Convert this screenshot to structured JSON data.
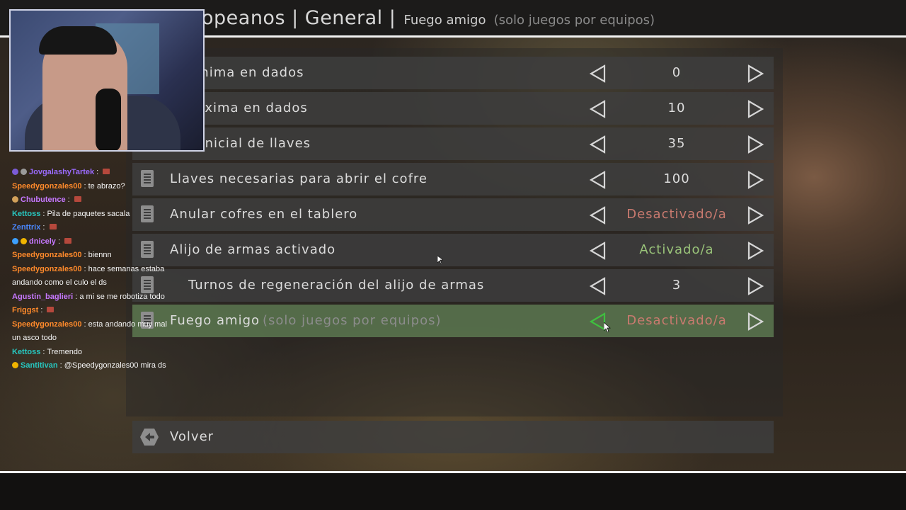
{
  "header": {
    "title": "opeanos | General |",
    "subtitle": "Fuego amigo",
    "subtitle_hint": "(solo juegos por equipos)"
  },
  "settings": [
    {
      "label": "a mínima en dados",
      "value": "0",
      "value_state": "normal"
    },
    {
      "label": "a máxima en dados",
      "value": "10",
      "value_state": "normal"
    },
    {
      "label": "dad inicial de llaves",
      "value": "35",
      "value_state": "normal"
    },
    {
      "label": "Llaves necesarias para abrir el cofre",
      "value": "100",
      "value_state": "normal"
    },
    {
      "label": "Anular cofres en el tablero",
      "value": "Desactivado/a",
      "value_state": "off"
    },
    {
      "label": "Alijo de armas activado",
      "value": "Activado/a",
      "value_state": "on"
    },
    {
      "label": "Turnos de regeneración del alijo de armas",
      "value": "3",
      "value_state": "normal"
    },
    {
      "label": "Fuego amigo",
      "label_hint": "(solo juegos por equipos)",
      "value": "Desactivado/a",
      "value_state": "off",
      "selected": true
    }
  ],
  "back_button": {
    "label": "Volver"
  },
  "chat": [
    {
      "user": "JovgalashyTartek",
      "user_color": "#9b6bff",
      "text": "",
      "emote": true,
      "badges": [
        "#7b5bd6",
        "#9a9a9a"
      ]
    },
    {
      "user": "Speedygonzales00",
      "user_color": "#ff8a2b",
      "text": "te abrazo?",
      "emote": false,
      "badges": []
    },
    {
      "user": "Chubutence",
      "user_color": "#c678ff",
      "text": "",
      "emote": true,
      "badges": [
        "#d2a15a"
      ]
    },
    {
      "user": "Kettoss",
      "user_color": "#27c7c0",
      "text": "Pila de paquetes sacala",
      "emote": false,
      "badges": []
    },
    {
      "user": "Zenttrix",
      "user_color": "#4a88ff",
      "text": "",
      "emote": true,
      "badges": []
    },
    {
      "user": "dnicely",
      "user_color": "#c678ff",
      "text": "",
      "emote": true,
      "badges": [
        "#3da0ff",
        "#f0b400"
      ]
    },
    {
      "user": "Speedygonzales00",
      "user_color": "#ff8a2b",
      "text": "biennn",
      "emote": false,
      "badges": []
    },
    {
      "user": "Speedygonzales00",
      "user_color": "#ff8a2b",
      "text": "hace semanas estaba andando como el culo el ds",
      "emote": false,
      "badges": []
    },
    {
      "user": "Agustin_baglieri",
      "user_color": "#c678ff",
      "text": "a mi se me robotiza todo",
      "emote": false,
      "badges": []
    },
    {
      "user": "Friggst",
      "user_color": "#ff8a2b",
      "text": "",
      "emote": true,
      "badges": []
    },
    {
      "user": "Speedygonzales00",
      "user_color": "#ff8a2b",
      "text": "esta andando muy mal un asco todo",
      "emote": false,
      "badges": []
    },
    {
      "user": "Kettoss",
      "user_color": "#27c7c0",
      "text": "Tremendo",
      "emote": false,
      "badges": []
    },
    {
      "user": "Santitivan",
      "user_color": "#27c7c0",
      "text": "@Speedygonzales00 mira ds",
      "emote": false,
      "badges": [
        "#f0b400"
      ]
    }
  ],
  "colors": {
    "accent_selected": "#5c7850",
    "value_off": "#c97a6f",
    "value_on": "#9ac47a",
    "arrow_active": "#3fbf3f"
  },
  "icons": {
    "row_icon": "document-icon",
    "back_icon": "back-hexagon-icon",
    "arrows": [
      "arrow-left-icon",
      "arrow-right-icon"
    ]
  }
}
